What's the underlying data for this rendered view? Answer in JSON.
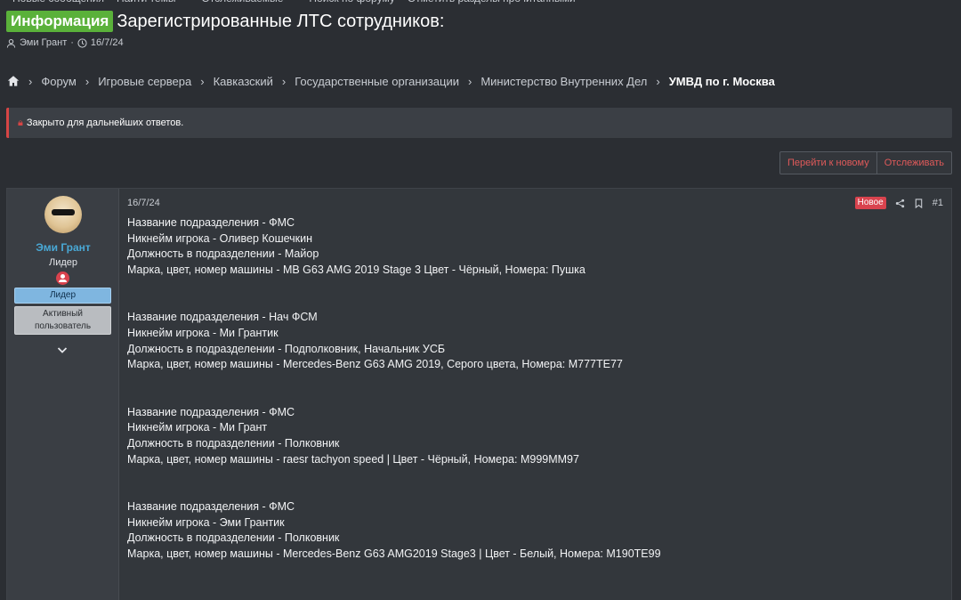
{
  "topnav": {
    "items": [
      "Новые сообщения",
      "Найти темы",
      "Отслеживаемые",
      "Поиск по форуму",
      "Отметить разделы прочитанными"
    ]
  },
  "thread": {
    "prefix": "Информация",
    "title": "Зарегистрированные ЛТС сотрудников:",
    "author": "Эми Грант",
    "date": "16/7/24"
  },
  "breadcrumb": {
    "items": [
      "Форум",
      "Игровые сервера",
      "Кавказский",
      "Государственные организации",
      "Министерство Внутренних Дел",
      "УМВД по г. Москва"
    ]
  },
  "notice": {
    "text": "Закрыто для дальнейших ответов."
  },
  "actions": {
    "goto_new": "Перейти к новому",
    "watch": "Отслеживать"
  },
  "post": {
    "user": {
      "name": "Эми Грант",
      "title": "Лидер",
      "banner_primary": "Лидер",
      "banner_secondary_line1": "Активный",
      "banner_secondary_line2": "пользователь"
    },
    "date": "16/7/24",
    "new_label": "Новое",
    "number": "#1",
    "entries": [
      {
        "division": "Название подразделения - ФМС",
        "nickname": "Никнейм игрока - Оливер Кошечкин",
        "position": "Должность в подразделении - Майор",
        "car": "Марка, цвет, номер машины - MB G63 AMG 2019 Stage 3 Цвет - Чёрный, Номера: Пушка"
      },
      {
        "division": "Название подразделения - Нач ФСМ",
        "nickname": "Никнейм игрока - Ми Грантик",
        "position": "Должность в подразделении - Подполковник, Начальник УСБ",
        "car": "Марка, цвет, номер машины - Mercedes-Benz G63 AMG 2019, Серого цвета, Номера: М777ТЕ77"
      },
      {
        "division": "Название подразделения - ФМС",
        "nickname": "Никнейм игрока - Ми Грант",
        "position": "Должность в подразделении - Полковник",
        "car": "Марка, цвет, номер машины - raesr tachyon speed | Цвет - Чёрный, Номера: М999ММ97"
      },
      {
        "division": "Название подразделения - ФМС",
        "nickname": "Никнейм игрока - Эми Грантик",
        "position": "Должность в подразделении - Полковник",
        "car": "Марка, цвет, номер машины - Mercedes-Benz G63 AMG2019 Stage3 | Цвет - Белый, Номера: М190ТЕ99"
      }
    ]
  },
  "colors": {
    "prefix_badge": "#5ab13a",
    "username": "#49a9d6",
    "accent_red": "#d9434e",
    "banner_lead": "#7fb6e0"
  }
}
